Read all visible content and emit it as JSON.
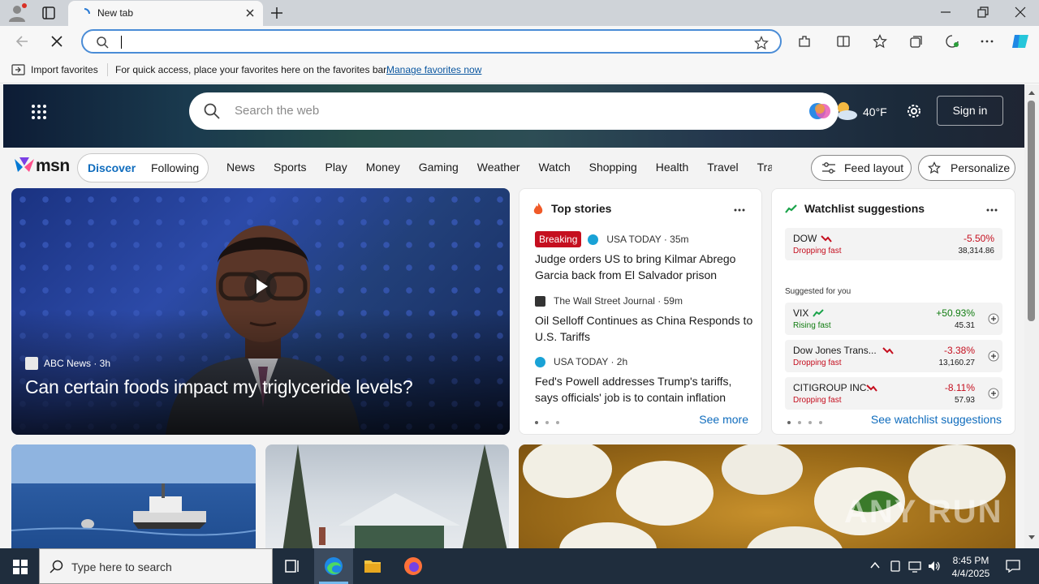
{
  "browser": {
    "tab_title": "New tab",
    "address_value": "",
    "favorites_bar": {
      "import_label": "Import favorites",
      "message": "For quick access, place your favorites here on the favorites bar.",
      "link": "Manage favorites now"
    }
  },
  "msn": {
    "search_placeholder": "Search the web",
    "weather_temp": "40°F",
    "sign_in": "Sign in",
    "logo_text": "msn",
    "feed_tabs": [
      "Discover",
      "Following"
    ],
    "categories": [
      "News",
      "Sports",
      "Play",
      "Money",
      "Gaming",
      "Weather",
      "Watch",
      "Shopping",
      "Health",
      "Travel",
      "Trav"
    ],
    "feed_layout": "Feed layout",
    "personalize": "Personalize",
    "main_story": {
      "source": "ABC News · 3h",
      "title": "Can certain foods impact my triglyceride levels?"
    },
    "top_stories": {
      "title": "Top stories",
      "breaking": "Breaking",
      "items": [
        {
          "source": "USA TODAY · 35m",
          "headline": "Judge orders US to bring Kilmar Abrego Garcia back from El Salvador prison"
        },
        {
          "source": "The Wall Street Journal · 59m",
          "headline": "Oil Selloff Continues as China Responds to U.S. Tariffs"
        },
        {
          "source": "USA TODAY · 2h",
          "headline": "Fed's Powell addresses Trump's tariffs, says officials' job is to contain inflation"
        }
      ],
      "see_more": "See more"
    },
    "watchlist": {
      "title": "Watchlist suggestions",
      "suggested_label": "Suggested for you",
      "stocks": [
        {
          "name": "DOW",
          "trend": "Dropping fast",
          "change": "-5.50%",
          "price": "38,314.86",
          "direction": "down"
        },
        {
          "name": "VIX",
          "trend": "Rising fast",
          "change": "+50.93%",
          "price": "45.31",
          "direction": "up"
        },
        {
          "name": "Dow Jones Trans...",
          "trend": "Dropping fast",
          "change": "-3.38%",
          "price": "13,160.27",
          "direction": "down"
        },
        {
          "name": "CITIGROUP INC.",
          "trend": "Dropping fast",
          "change": "-8.11%",
          "price": "57.93",
          "direction": "down"
        }
      ],
      "see_all": "See watchlist suggestions"
    },
    "watermark": "ANY RUN"
  },
  "taskbar": {
    "search_placeholder": "Type here to search",
    "time": "8:45 PM",
    "date": "4/4/2025"
  },
  "colors": {
    "accent": "#0f6cbd",
    "negative": "#c50f1f",
    "positive": "#107c10",
    "address_border": "#4a8cd6",
    "taskbar": "#1f2d3d"
  }
}
